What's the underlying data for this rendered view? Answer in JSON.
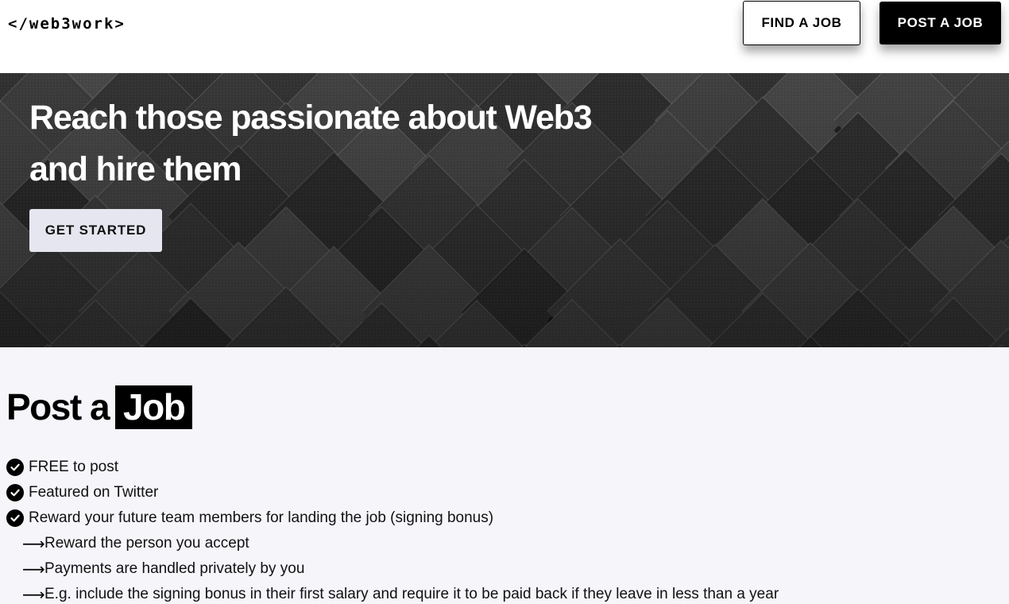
{
  "header": {
    "logo": "</web3work>",
    "find_job_label": "FIND A JOB",
    "post_job_label": "POST A JOB"
  },
  "hero": {
    "title_line1": "Reach those passionate about Web3",
    "title_line2": "and hire them",
    "cta_label": "GET STARTED"
  },
  "post_section": {
    "heading_prefix": "Post a",
    "heading_highlight": "Job",
    "features": [
      "FREE to post",
      "Featured on Twitter",
      "Reward your future team members for landing the job (signing bonus)"
    ],
    "sub_points": [
      "Reward the person you accept",
      "Payments are handled privately by you",
      "E.g. include the signing bonus in their first salary and require it to be paid back if they leave in less than a year"
    ],
    "check_icon": "check-circle-icon",
    "arrow_icon": "long-arrow-right-icon"
  },
  "colors": {
    "page_bg": "#f5f5fa",
    "header_bg": "#ffffff",
    "primary": "#000000",
    "hero_bg": "#202020",
    "cta_bg": "#e6e6f0"
  }
}
